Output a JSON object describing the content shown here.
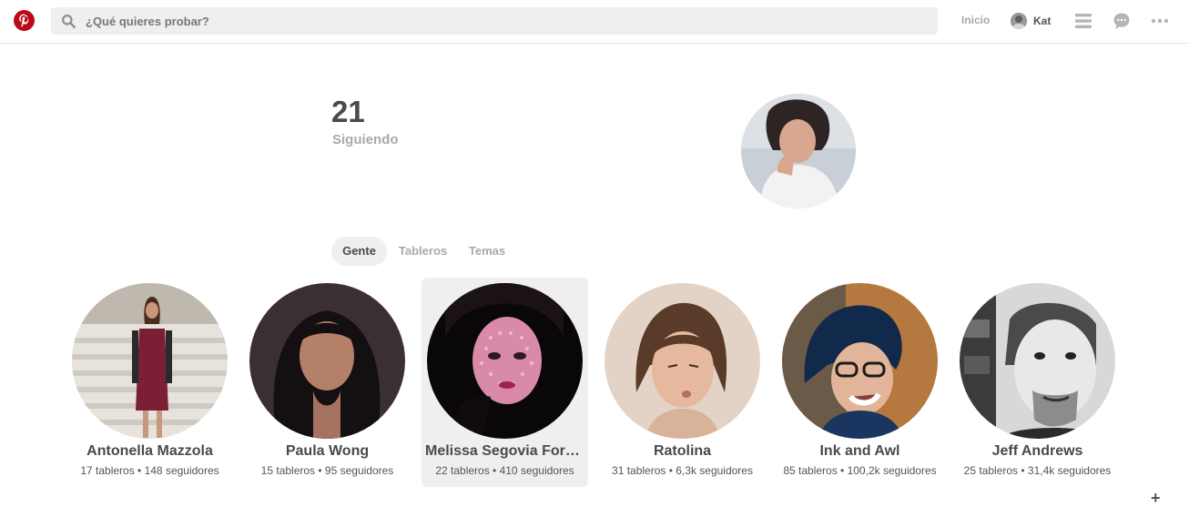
{
  "header": {
    "search_placeholder": "¿Qué quieres probar?",
    "home_label": "Inicio",
    "user_name": "Kat",
    "icons": [
      "pinterest-logo",
      "search-icon",
      "menu-icon",
      "messages-icon",
      "more-icon"
    ],
    "brand_color": "#bd081c"
  },
  "profile": {
    "following_count": "21",
    "following_label": "Siguiendo"
  },
  "tabs": [
    {
      "label": "Gente",
      "active": true
    },
    {
      "label": "Tableros",
      "active": false
    },
    {
      "label": "Temas",
      "active": false
    }
  ],
  "people": [
    {
      "name": "Antonella Mazzola",
      "stats": "17 tableros • 148 seguidores"
    },
    {
      "name": "Paula Wong",
      "stats": "15 tableros • 95 seguidores"
    },
    {
      "name": "Melissa Segovia Forr…",
      "stats": "22 tableros • 410 seguidores"
    },
    {
      "name": "Ratolina",
      "stats": "31 tableros • 6,3k seguidores"
    },
    {
      "name": "Ink and Awl",
      "stats": "85 tableros • 100,2k seguidores"
    },
    {
      "name": "Jeff Andrews",
      "stats": "25 tableros • 31,4k seguidores"
    }
  ],
  "footer": {
    "plus_label": "+"
  }
}
